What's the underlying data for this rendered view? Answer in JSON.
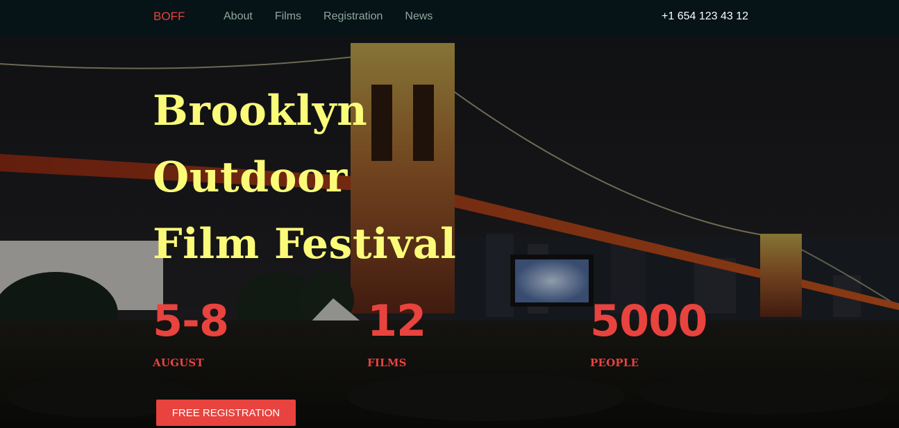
{
  "nav": {
    "brand": "BOFF",
    "links": [
      "About",
      "Films",
      "Registration",
      "News"
    ],
    "phone": "+1 654 123 43 12"
  },
  "hero": {
    "title_lines": [
      "Brooklyn",
      "Outdoor",
      "Film Festival"
    ],
    "stats": [
      {
        "value": "5-8",
        "label": "AUGUST"
      },
      {
        "value": "12",
        "label": "FILMS"
      },
      {
        "value": "5000",
        "label": "PEOPLE"
      }
    ],
    "cta_label": "FREE REGISTRATION"
  },
  "colors": {
    "accent": "#e8433e",
    "title": "#fbfb7a",
    "navbar_bg": "#061317",
    "nav_link": "#8fa89c"
  }
}
